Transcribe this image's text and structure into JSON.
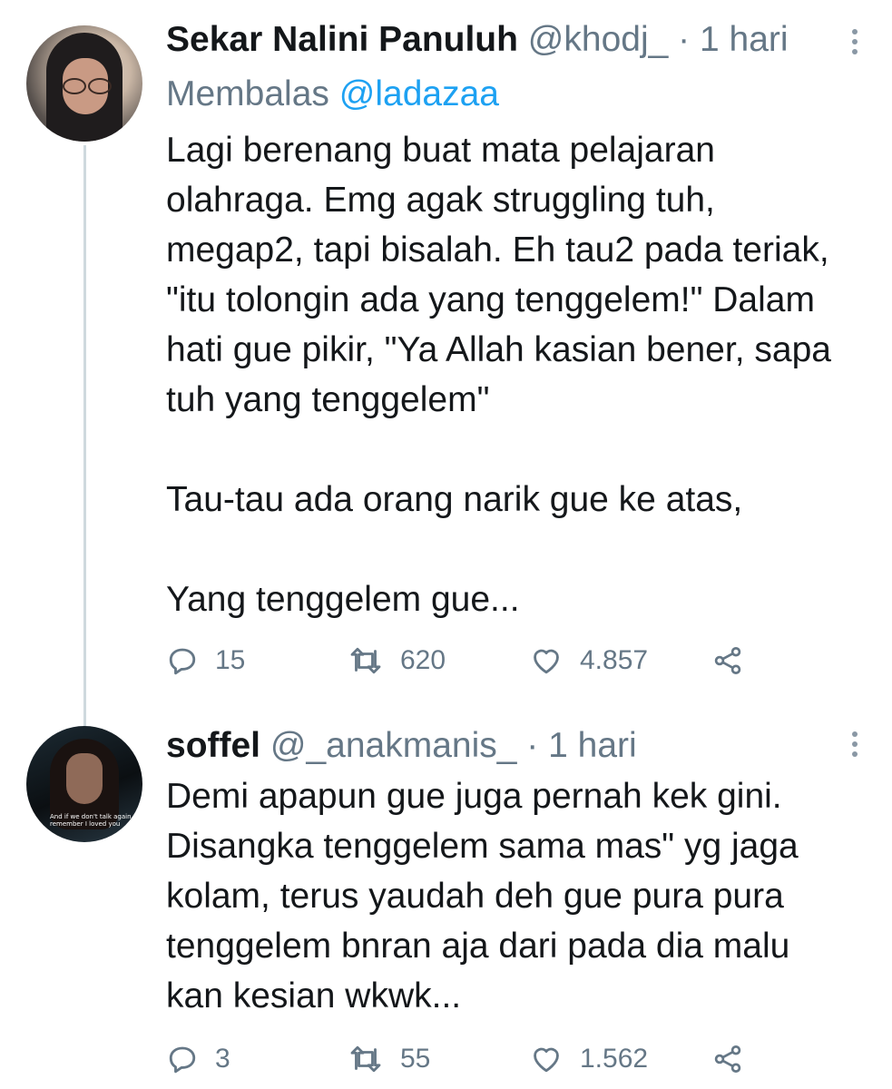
{
  "colors": {
    "text": "#14171a",
    "muted": "#657786",
    "link": "#1da1f2",
    "thread_line": "#cfd9de"
  },
  "tweets": [
    {
      "name": "Sekar Nalini Panuluh",
      "handle": "@khodj_",
      "separator": "·",
      "time": "1 hari",
      "reply_prefix": "Membalas",
      "reply_mention": "@ladazaa",
      "text": "Lagi berenang buat mata pelajaran\nolahraga. Emg agak struggling tuh,\nmegap2, tapi bisalah. Eh tau2 pada teriak,\n\"itu tolongin ada yang tenggelem!\" Dalam\nhati gue pikir, \"Ya Allah kasian bener, sapa\ntuh yang tenggelem\"\n\nTau-tau ada orang narik gue ke atas,\n\nYang tenggelem gue...",
      "replies": "15",
      "retweets": "620",
      "likes": "4.857",
      "icons": [
        "more-vertical-icon",
        "reply-icon",
        "retweet-icon",
        "like-icon",
        "share-icon"
      ]
    },
    {
      "name": "soffel",
      "handle": "@_anakmanis_",
      "separator": "·",
      "time": "1 hari",
      "avatar_caption": "And if we don't talk again remember I loved you",
      "text": "Demi apapun gue juga pernah kek gini.\nDisangka tenggelem sama mas\" yg jaga\nkolam, terus yaudah deh gue pura pura\ntenggelem bnran aja dari pada dia malu\nkan kesian wkwk...",
      "replies": "3",
      "retweets": "55",
      "likes": "1.562",
      "icons": [
        "more-vertical-icon",
        "reply-icon",
        "retweet-icon",
        "like-icon",
        "share-icon"
      ]
    }
  ]
}
